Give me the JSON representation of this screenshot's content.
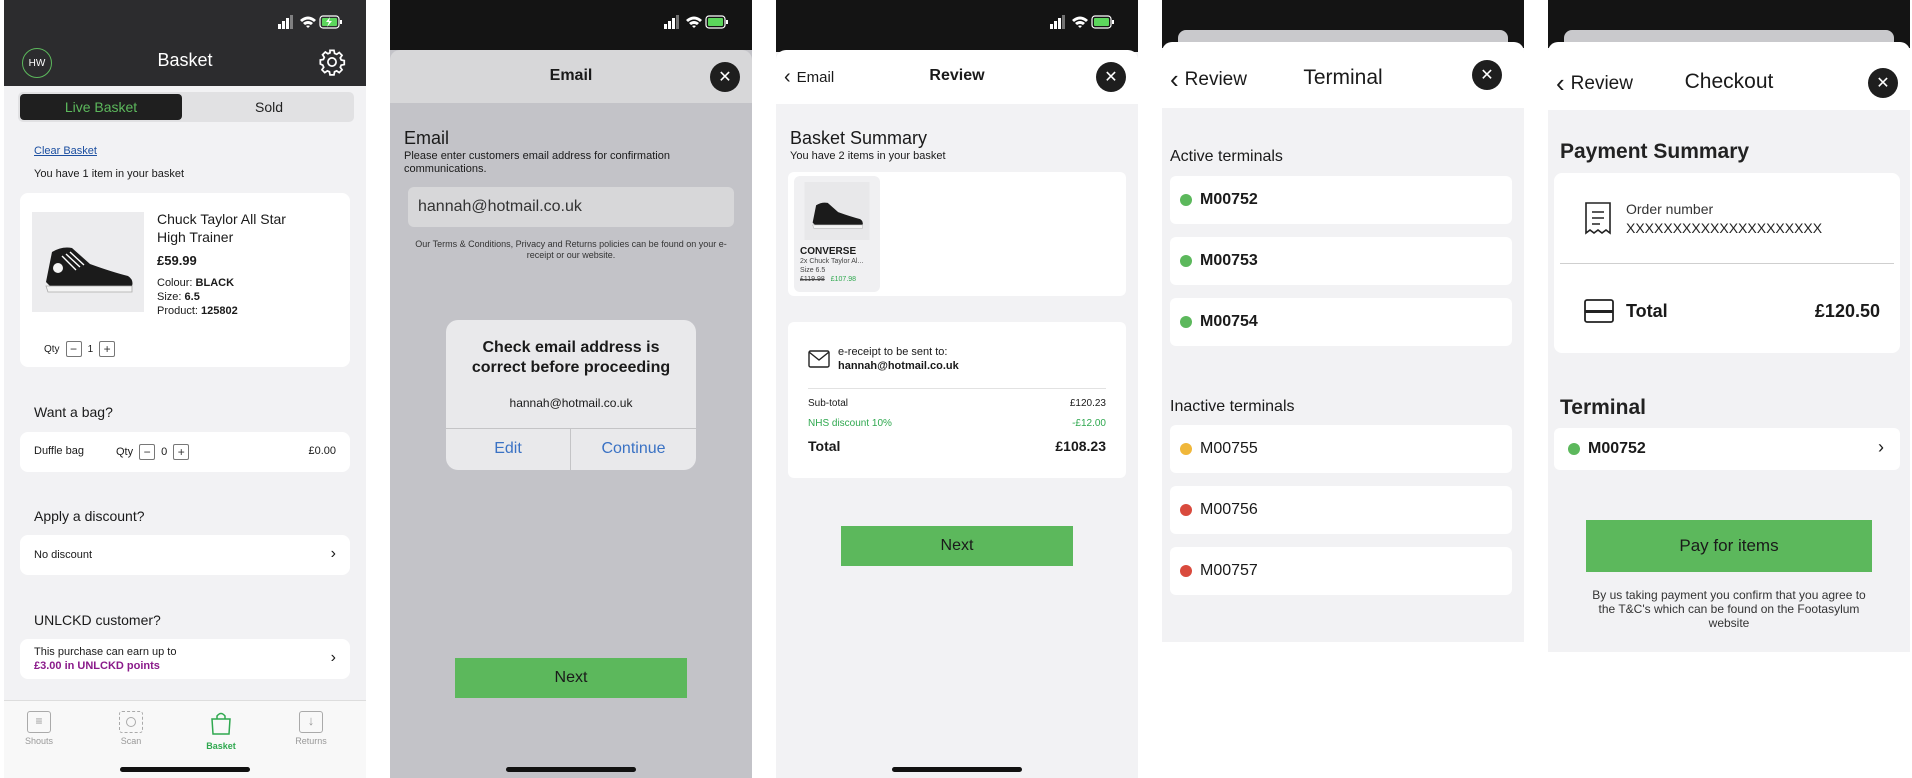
{
  "status_bar": {
    "icons": [
      "signal-icon",
      "wifi-icon",
      "battery-charging-icon"
    ]
  },
  "screen1": {
    "avatar": "HW",
    "title": "Basket",
    "tabs": {
      "live": "Live Basket",
      "sold": "Sold"
    },
    "clear_basket": "Clear Basket",
    "item_count": "You have 1 item in your basket",
    "product": {
      "name": "Chuck Taylor All Star High Trainer",
      "price": "£59.99",
      "colour_label": "Colour:",
      "colour": "BLACK",
      "size_label": "Size:",
      "size": "6.5",
      "product_label": "Product:",
      "product_id": "125802",
      "qty_label": "Qty",
      "qty": "1"
    },
    "bag": {
      "heading": "Want a bag?",
      "name": "Duffle bag",
      "qty_label": "Qty",
      "qty": "0",
      "price": "£0.00"
    },
    "discount": {
      "heading": "Apply a discount?",
      "value": "No discount"
    },
    "unlckd": {
      "heading": "UNLCKD customer?",
      "line1": "This purchase can earn up to",
      "line2": "£3.00 in UNLCKD points"
    },
    "nav": [
      {
        "label": "Shouts",
        "icon": "list-icon"
      },
      {
        "label": "Scan",
        "icon": "scan-icon"
      },
      {
        "label": "Basket",
        "icon": "bag-icon"
      },
      {
        "label": "Returns",
        "icon": "returns-icon"
      }
    ]
  },
  "screen2": {
    "title": "Email",
    "heading": "Email",
    "instructions": "Please enter customers email address for confirmation communications.",
    "email_value": "hannah@hotmail.co.uk",
    "terms": "Our Terms & Conditions, Privacy and Returns policies can be found on your e-receipt or our website.",
    "alert": {
      "title": "Check email address is correct before proceeding",
      "email": "hannah@hotmail.co.uk",
      "edit": "Edit",
      "continue": "Continue"
    },
    "next": "Next"
  },
  "screen3": {
    "back": "Email",
    "title": "Review",
    "summary_title": "Basket Summary",
    "summary_sub": "You have 2 items in your basket",
    "item": {
      "brand": "CONVERSE",
      "desc": "2x Chuck Taylor Al...",
      "size": "Size 6.5",
      "old_price": "£119.98",
      "new_price": "£107.98"
    },
    "receipt_label": "e-receipt to be sent to:",
    "receipt_email": "hannah@hotmail.co.uk",
    "subtotal_label": "Sub-total",
    "subtotal": "£120.23",
    "discount_label": "NHS discount 10%",
    "discount": "-£12.00",
    "total_label": "Total",
    "total": "£108.23",
    "next": "Next",
    "colors": {
      "green": "#2fa84f"
    }
  },
  "screen4": {
    "back": "Review",
    "title": "Terminal",
    "active_heading": "Active terminals",
    "active": [
      "M00752",
      "M00753",
      "M00754"
    ],
    "inactive_heading": "Inactive terminals",
    "inactive": [
      {
        "id": "M00755",
        "color": "#f0b73a"
      },
      {
        "id": "M00756",
        "color": "#d94a3d"
      },
      {
        "id": "M00757",
        "color": "#d94a3d"
      }
    ],
    "active_color": "#5cb85c"
  },
  "screen5": {
    "back": "Review",
    "title": "Checkout",
    "payment_heading": "Payment Summary",
    "order_label": "Order number",
    "order_value": "XXXXXXXXXXXXXXXXXXXXX",
    "total_label": "Total",
    "total_value": "£120.50",
    "terminal_heading": "Terminal",
    "terminal": "M00752",
    "pay_button": "Pay for items",
    "disclaimer": "By us taking payment you confirm that you agree to the T&C's which can be found on the Footasylum website"
  }
}
